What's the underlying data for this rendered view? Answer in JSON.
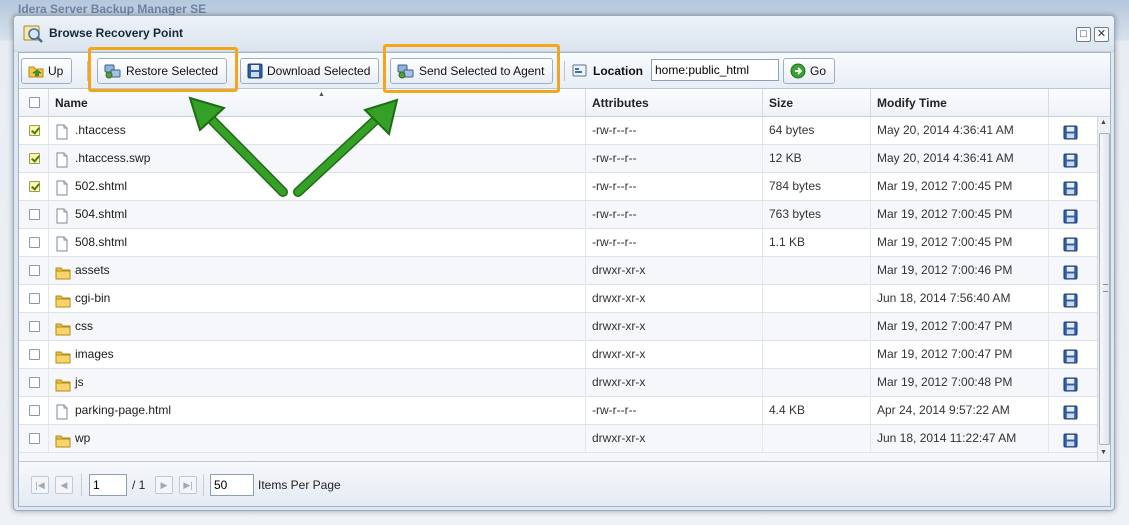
{
  "background_app": {
    "title": "Idera Server Backup Manager SE"
  },
  "dialog": {
    "title": "Browse Recovery Point",
    "maximize_symbol": "□",
    "close_symbol": "✕"
  },
  "toolbar": {
    "up_label": "Up",
    "restore_label": "Restore Selected",
    "download_label": "Download Selected",
    "send_label": "Send Selected to Agent",
    "location_label": "Location",
    "location_value": "home:public_html",
    "go_label": "Go"
  },
  "grid": {
    "columns": [
      "Name",
      "Attributes",
      "Size",
      "Modify Time"
    ],
    "rows": [
      {
        "checked": true,
        "icon": "file-icon",
        "name": ".htaccess",
        "attributes": "-rw-r--r--",
        "size": "64 bytes",
        "modified": "May 20, 2014 4:36:41 AM"
      },
      {
        "checked": true,
        "icon": "file-icon",
        "name": ".htaccess.swp",
        "attributes": "-rw-r--r--",
        "size": "12 KB",
        "modified": "May 20, 2014 4:36:41 AM"
      },
      {
        "checked": true,
        "icon": "file-icon",
        "name": "502.shtml",
        "attributes": "-rw-r--r--",
        "size": "784 bytes",
        "modified": "Mar 19, 2012 7:00:45 PM"
      },
      {
        "checked": false,
        "icon": "file-icon",
        "name": "504.shtml",
        "attributes": "-rw-r--r--",
        "size": "763 bytes",
        "modified": "Mar 19, 2012 7:00:45 PM"
      },
      {
        "checked": false,
        "icon": "file-icon",
        "name": "508.shtml",
        "attributes": "-rw-r--r--",
        "size": "1.1 KB",
        "modified": "Mar 19, 2012 7:00:45 PM"
      },
      {
        "checked": false,
        "icon": "folder-icon",
        "name": "assets",
        "attributes": "drwxr-xr-x",
        "size": "",
        "modified": "Mar 19, 2012 7:00:46 PM"
      },
      {
        "checked": false,
        "icon": "folder-icon",
        "name": "cgi-bin",
        "attributes": "drwxr-xr-x",
        "size": "",
        "modified": "Jun 18, 2014 7:56:40 AM"
      },
      {
        "checked": false,
        "icon": "folder-icon",
        "name": "css",
        "attributes": "drwxr-xr-x",
        "size": "",
        "modified": "Mar 19, 2012 7:00:47 PM"
      },
      {
        "checked": false,
        "icon": "folder-icon",
        "name": "images",
        "attributes": "drwxr-xr-x",
        "size": "",
        "modified": "Mar 19, 2012 7:00:47 PM"
      },
      {
        "checked": false,
        "icon": "folder-icon",
        "name": "js",
        "attributes": "drwxr-xr-x",
        "size": "",
        "modified": "Mar 19, 2012 7:00:48 PM"
      },
      {
        "checked": false,
        "icon": "file-icon",
        "name": "parking-page.html",
        "attributes": "-rw-r--r--",
        "size": "4.4 KB",
        "modified": "Apr 24, 2014 9:57:22 AM"
      },
      {
        "checked": false,
        "icon": "folder-icon",
        "name": "wp",
        "attributes": "drwxr-xr-x",
        "size": "",
        "modified": "Jun 18, 2014 11:22:47 AM"
      }
    ]
  },
  "pager": {
    "page_value": "1",
    "page_total": "/ 1",
    "per_page_value": "50",
    "per_page_label": "Items Per Page"
  },
  "colors": {
    "highlight": "#f3a51b",
    "arrow": "#2f8a22",
    "selected_checkbox": "#fdf8a8"
  }
}
